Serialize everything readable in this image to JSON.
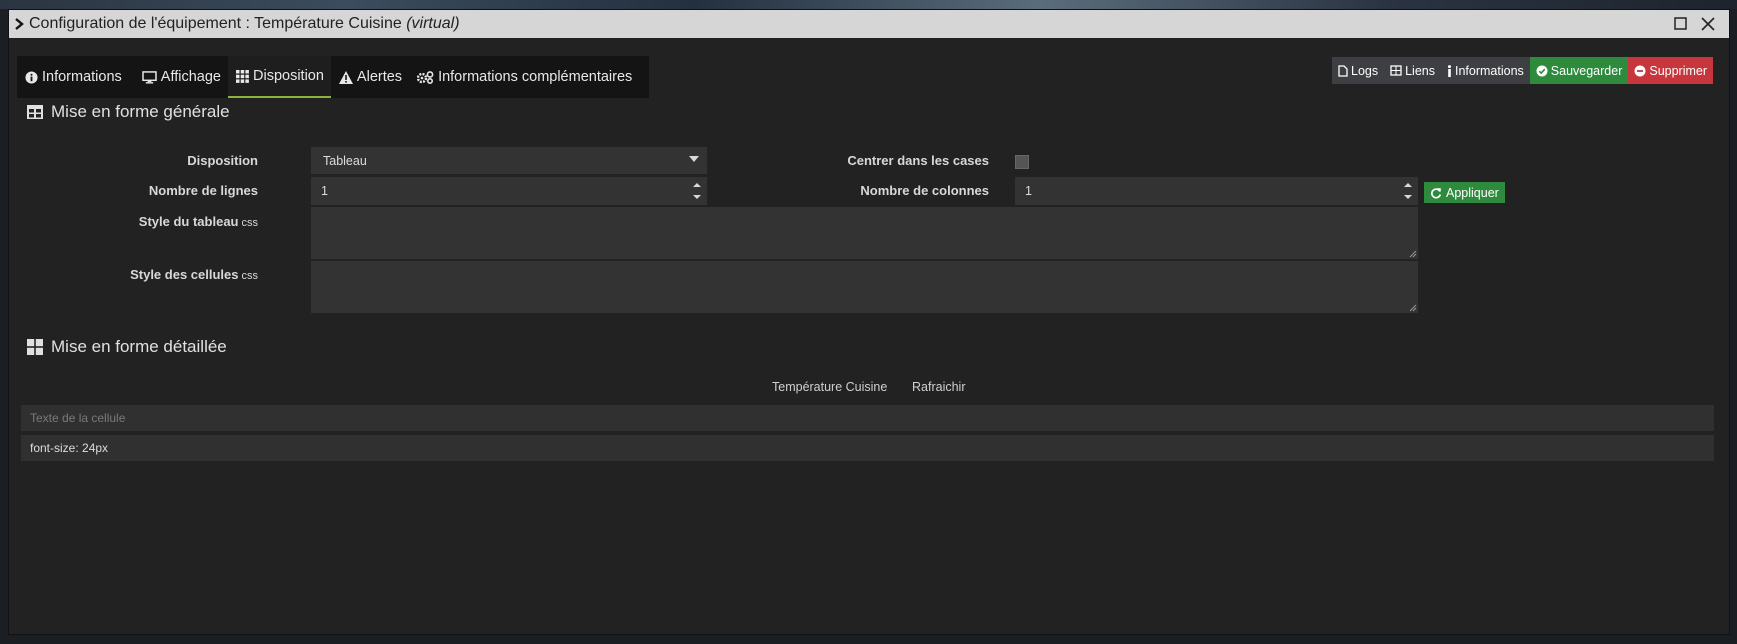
{
  "window": {
    "title_prefix": "Configuration de l'équipement : Température Cuisine ",
    "title_suffix": "(virtual)"
  },
  "tabs": [
    {
      "label": "Informations",
      "icon": "info-circle-icon"
    },
    {
      "label": "Affichage",
      "icon": "monitor-icon"
    },
    {
      "label": "Disposition",
      "icon": "grid-icon",
      "active": true
    },
    {
      "label": "Alertes",
      "icon": "warning-icon"
    },
    {
      "label": "Informations complémentaires",
      "icon": "gears-icon"
    }
  ],
  "actions": {
    "logs": "Logs",
    "liens": "Liens",
    "informations": "Informations",
    "sauvegarder": "Sauvegarder",
    "supprimer": "Supprimer"
  },
  "general": {
    "title": "Mise en forme générale",
    "disposition_label": "Disposition",
    "disposition_value": "Tableau",
    "centrer_label": "Centrer dans les cases",
    "centrer_checked": false,
    "lignes_label": "Nombre de lignes",
    "lignes_value": "1",
    "colonnes_label": "Nombre de colonnes",
    "colonnes_value": "1",
    "appliquer": "Appliquer",
    "style_tableau_label": "Style du tableau",
    "style_tableau_sub": "css",
    "style_cellules_label": "Style des cellules",
    "style_cellules_sub": "css"
  },
  "detail": {
    "title": "Mise en forme détaillée",
    "cell_headers": [
      "Température Cuisine",
      "Rafraichir"
    ],
    "cell_text_placeholder": "Texte de la cellule",
    "cell_style_value": "font-size: 24px"
  },
  "colors": {
    "accent_green": "#2e8b3e",
    "danger_red": "#c8363d",
    "active_tab_underline": "#8bb43a"
  }
}
